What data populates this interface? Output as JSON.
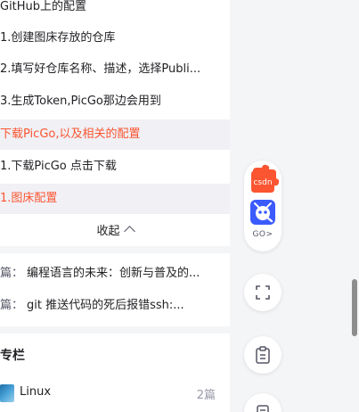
{
  "toc": {
    "items": [
      {
        "label": "GitHub上的配置"
      },
      {
        "label": "1.创建图床存放的仓库"
      },
      {
        "label": "2.填写好仓库名称、描述，选择Publi..."
      },
      {
        "label": "3.生成Token,PicGo那边会用到"
      },
      {
        "label": "下载PicGo,以及相关的配置"
      },
      {
        "label": "1.下载PicGo 点击下载"
      },
      {
        "label": "1.图床配置"
      }
    ],
    "collapse_label": "收起"
  },
  "article_nav": {
    "prev_prefix": "篇：",
    "prev_title": "编程语言的未来：创新与普及的...",
    "next_prefix": "篇：",
    "next_title": "git 推送代码的死后报错ssh:..."
  },
  "column": {
    "title": "专栏",
    "items": [
      {
        "name": "Linux",
        "count": "2篇"
      }
    ]
  },
  "toolbar": {
    "csdn_label": "csdn",
    "go_label": "GO>"
  },
  "colors": {
    "accent_red": "#fc5531",
    "csdn_orange": "#fc5531",
    "go_blue": "#3b5bff"
  },
  "icons": {
    "csdn": "csdn-logo-icon",
    "go": "go-robot-icon",
    "fullscreen": "fullscreen-icon",
    "clipboard": "clipboard-icon",
    "document": "document-icon"
  }
}
